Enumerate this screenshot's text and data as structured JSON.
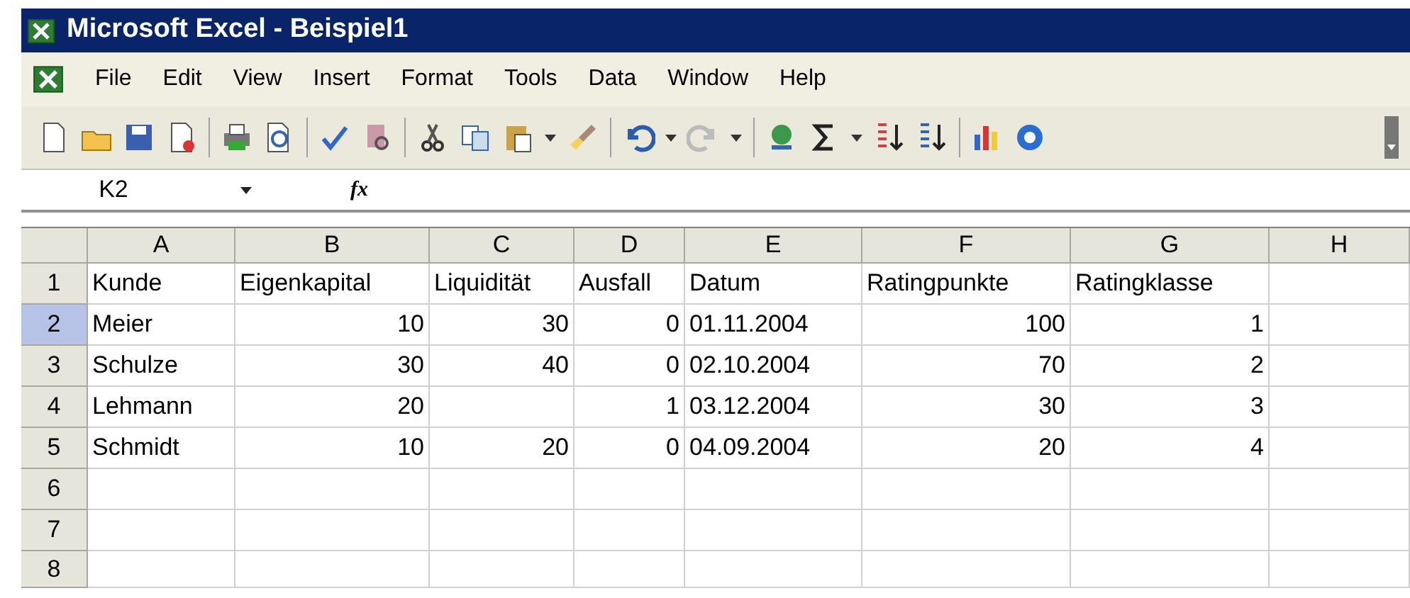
{
  "window": {
    "title": "Microsoft Excel - Beispiel1"
  },
  "menu": [
    "File",
    "Edit",
    "View",
    "Insert",
    "Format",
    "Tools",
    "Data",
    "Window",
    "Help"
  ],
  "name_box": {
    "value": "K2"
  },
  "formula_bar": {
    "fx": "fx"
  },
  "columns": [
    {
      "label": "A",
      "selected": false
    },
    {
      "label": "B",
      "selected": false
    },
    {
      "label": "C",
      "selected": false
    },
    {
      "label": "D",
      "selected": false
    },
    {
      "label": "E",
      "selected": false
    },
    {
      "label": "F",
      "selected": false
    },
    {
      "label": "G",
      "selected": false
    },
    {
      "label": "H",
      "selected": false
    }
  ],
  "rows": [
    {
      "label": "1",
      "selected": false,
      "cells": [
        {
          "v": "Kunde",
          "kind": "text"
        },
        {
          "v": "Eigenkapital",
          "kind": "text"
        },
        {
          "v": "Liquidität",
          "kind": "text"
        },
        {
          "v": "Ausfall",
          "kind": "text"
        },
        {
          "v": "Datum",
          "kind": "text"
        },
        {
          "v": "Ratingpunkte",
          "kind": "text"
        },
        {
          "v": "Ratingklasse",
          "kind": "text"
        },
        null
      ]
    },
    {
      "label": "2",
      "selected": true,
      "cells": [
        {
          "v": "Meier",
          "kind": "text"
        },
        {
          "v": "10",
          "kind": "number"
        },
        {
          "v": "30",
          "kind": "number"
        },
        {
          "v": "0",
          "kind": "number"
        },
        {
          "v": "01.11.2004",
          "kind": "text"
        },
        {
          "v": "100",
          "kind": "number"
        },
        {
          "v": "1",
          "kind": "number"
        },
        null
      ]
    },
    {
      "label": "3",
      "selected": false,
      "cells": [
        {
          "v": "Schulze",
          "kind": "text"
        },
        {
          "v": "30",
          "kind": "number"
        },
        {
          "v": "40",
          "kind": "number"
        },
        {
          "v": "0",
          "kind": "number"
        },
        {
          "v": "02.10.2004",
          "kind": "text"
        },
        {
          "v": "70",
          "kind": "number"
        },
        {
          "v": "2",
          "kind": "number"
        },
        null
      ]
    },
    {
      "label": "4",
      "selected": false,
      "cells": [
        {
          "v": "Lehmann",
          "kind": "text"
        },
        {
          "v": "20",
          "kind": "number"
        },
        null,
        {
          "v": "1",
          "kind": "number"
        },
        {
          "v": "03.12.2004",
          "kind": "text"
        },
        {
          "v": "30",
          "kind": "number"
        },
        {
          "v": "3",
          "kind": "number"
        },
        null
      ]
    },
    {
      "label": "5",
      "selected": false,
      "cells": [
        {
          "v": "Schmidt",
          "kind": "text"
        },
        {
          "v": "10",
          "kind": "number"
        },
        {
          "v": "20",
          "kind": "number"
        },
        {
          "v": "0",
          "kind": "number"
        },
        {
          "v": "04.09.2004",
          "kind": "text"
        },
        {
          "v": "20",
          "kind": "number"
        },
        {
          "v": "4",
          "kind": "number"
        },
        null
      ]
    },
    {
      "label": "6",
      "selected": false,
      "cells": [
        null,
        null,
        null,
        null,
        null,
        null,
        null,
        null
      ]
    },
    {
      "label": "7",
      "selected": false,
      "cells": [
        null,
        null,
        null,
        null,
        null,
        null,
        null,
        null
      ]
    },
    {
      "label": "8",
      "selected": false,
      "cells": [
        null,
        null,
        null,
        null,
        null,
        null,
        null,
        null
      ]
    }
  ]
}
